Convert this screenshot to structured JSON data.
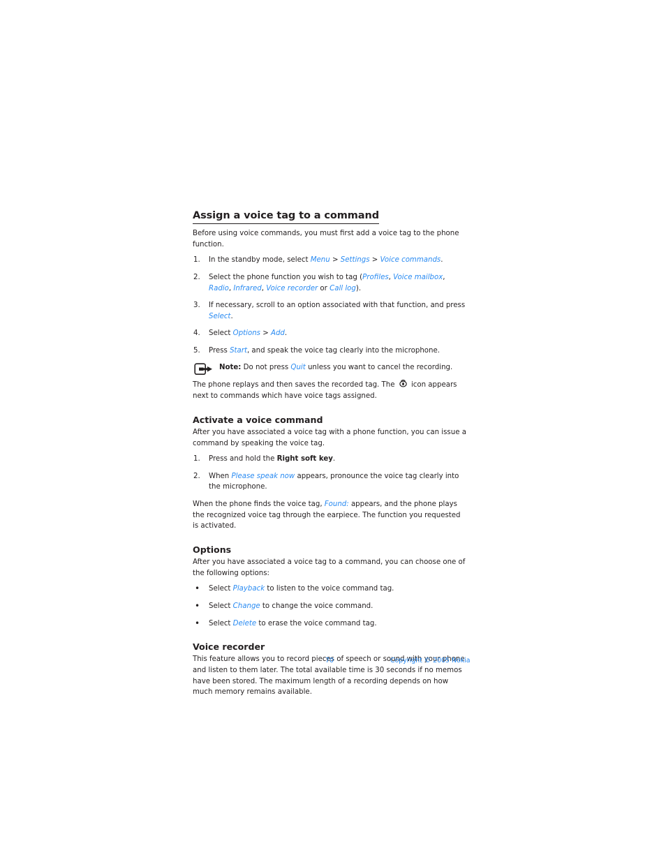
{
  "document": {
    "section_heading": "Assign a voice tag to a command",
    "intro": "Before using voice commands, you must first add a voice tag to the phone function.",
    "steps_assign": [
      {
        "number": "1.",
        "parts": [
          {
            "text": "In the standby mode, select ",
            "style": "plain"
          },
          {
            "text": "Menu",
            "style": "ui"
          },
          {
            "text": " > ",
            "style": "plain"
          },
          {
            "text": "Settings",
            "style": "ui"
          },
          {
            "text": " > ",
            "style": "plain"
          },
          {
            "text": "Voice commands",
            "style": "ui"
          },
          {
            "text": ".",
            "style": "plain"
          }
        ]
      },
      {
        "number": "2.",
        "parts": [
          {
            "text": "Select the phone function you wish to tag (",
            "style": "plain"
          },
          {
            "text": "Profiles",
            "style": "ui"
          },
          {
            "text": ", ",
            "style": "plain"
          },
          {
            "text": "Voice mailbox",
            "style": "ui"
          },
          {
            "text": ", ",
            "style": "plain"
          },
          {
            "text": "Radio",
            "style": "ui"
          },
          {
            "text": ", ",
            "style": "plain"
          },
          {
            "text": "Infrared",
            "style": "ui"
          },
          {
            "text": ", ",
            "style": "plain"
          },
          {
            "text": "Voice recorder",
            "style": "ui"
          },
          {
            "text": " or ",
            "style": "plain"
          },
          {
            "text": "Call log",
            "style": "ui"
          },
          {
            "text": ").",
            "style": "plain"
          }
        ]
      },
      {
        "number": "3.",
        "parts": [
          {
            "text": "If necessary, scroll to an option associated with that function, and press ",
            "style": "plain"
          },
          {
            "text": "Select",
            "style": "ui"
          },
          {
            "text": ".",
            "style": "plain"
          }
        ]
      },
      {
        "number": "4.",
        "parts": [
          {
            "text": "Select ",
            "style": "plain"
          },
          {
            "text": "Options",
            "style": "ui"
          },
          {
            "text": " > ",
            "style": "plain"
          },
          {
            "text": "Add",
            "style": "ui"
          },
          {
            "text": ".",
            "style": "plain"
          }
        ]
      },
      {
        "number": "5.",
        "parts": [
          {
            "text": "Press ",
            "style": "plain"
          },
          {
            "text": "Start",
            "style": "ui"
          },
          {
            "text": ", and speak the voice tag clearly into the microphone.",
            "style": "plain"
          }
        ]
      }
    ],
    "note": {
      "icon": "note-pointer-icon",
      "parts": [
        {
          "text": "Note:",
          "style": "bold"
        },
        {
          "text": " Do not press ",
          "style": "plain"
        },
        {
          "text": "Quit",
          "style": "ui"
        },
        {
          "text": " unless you want to cancel the recording.",
          "style": "plain"
        }
      ]
    },
    "after_note": {
      "parts": [
        {
          "text": "The phone replays and then saves the recorded tag. The ",
          "style": "plain"
        },
        {
          "text": "",
          "style": "icon",
          "icon": "voice-tag-icon"
        },
        {
          "text": " icon appears next to commands which have voice tags assigned.",
          "style": "plain"
        }
      ]
    },
    "activate": {
      "heading": "Activate a voice command",
      "intro": "After you have associated a voice tag with a phone function, you can issue a command by speaking the voice tag.",
      "steps": [
        {
          "number": "1.",
          "parts": [
            {
              "text": "Press and hold the ",
              "style": "plain"
            },
            {
              "text": "Right soft key",
              "style": "bold"
            },
            {
              "text": ".",
              "style": "plain"
            }
          ]
        },
        {
          "number": "2.",
          "parts": [
            {
              "text": "When ",
              "style": "plain"
            },
            {
              "text": "Please speak now",
              "style": "ui"
            },
            {
              "text": " appears, pronounce the voice tag clearly into the microphone.",
              "style": "plain"
            }
          ]
        }
      ],
      "outro": {
        "parts": [
          {
            "text": "When the phone finds the voice tag, ",
            "style": "plain"
          },
          {
            "text": "Found:",
            "style": "ui"
          },
          {
            "text": " appears, and the phone plays the recognized voice tag through the earpiece. The function you requested is activated.",
            "style": "plain"
          }
        ]
      }
    },
    "options": {
      "heading": "Options",
      "intro": "After you have associated a voice tag to a command, you can choose one of the following options:",
      "bullets": [
        {
          "marker": "•",
          "parts": [
            {
              "text": "Select ",
              "style": "plain"
            },
            {
              "text": "Playback",
              "style": "ui"
            },
            {
              "text": " to listen to the voice command tag.",
              "style": "plain"
            }
          ]
        },
        {
          "marker": "•",
          "parts": [
            {
              "text": "Select ",
              "style": "plain"
            },
            {
              "text": "Change",
              "style": "ui"
            },
            {
              "text": " to change the voice command.",
              "style": "plain"
            }
          ]
        },
        {
          "marker": "•",
          "parts": [
            {
              "text": "Select ",
              "style": "plain"
            },
            {
              "text": "Delete",
              "style": "ui"
            },
            {
              "text": " to erase the voice command tag.",
              "style": "plain"
            }
          ]
        }
      ]
    },
    "voice_recorder": {
      "heading": "Voice recorder",
      "body": "This feature allows you to record pieces of speech or sound with your phone and listen to them later. The total available time is 30 seconds if no memos have been stored. The maximum length of a recording depends on how much memory remains available."
    }
  },
  "footer": {
    "page_number": "70",
    "copyright": "Copyright © 2005 Nokia"
  },
  "colors": {
    "ui_link": "#2a8bf2",
    "body_text": "#231f20",
    "footer_text": "#2a8bf2"
  }
}
